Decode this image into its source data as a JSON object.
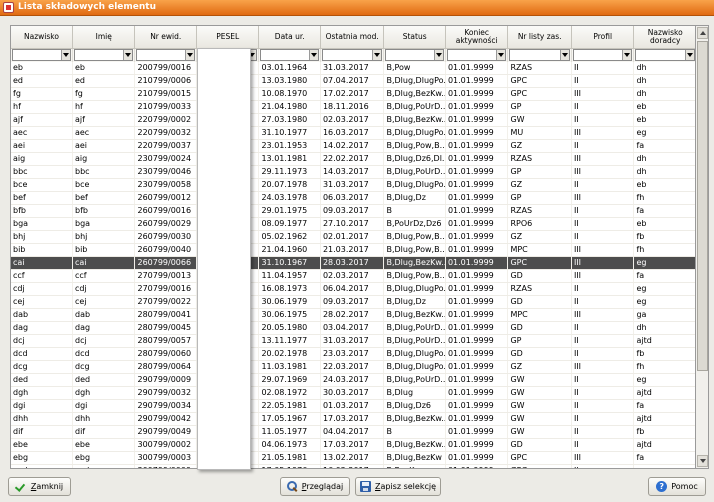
{
  "window": {
    "title": "Lista składowych elementu"
  },
  "columns": [
    "Nazwisko",
    "Imię",
    "Nr ewid.",
    "PESEL",
    "Data ur.",
    "Ostatnia mod.",
    "Status",
    "Koniec aktywności",
    "Nr listy zas.",
    "Profil",
    "Nazwisko doradcy"
  ],
  "rows": [
    [
      "eb",
      "eb",
      "200799/0016",
      "",
      "03.01.1964",
      "31.03.2017",
      "B,Pow",
      "01.01.9999",
      "RZAS",
      "II",
      "dh"
    ],
    [
      "ed",
      "ed",
      "210799/0006",
      "",
      "13.03.1980",
      "07.04.2017",
      "B,Dlug,DlugPo...",
      "01.01.9999",
      "GPC",
      "II",
      "dh"
    ],
    [
      "fg",
      "fg",
      "210799/0015",
      "",
      "10.08.1970",
      "17.02.2017",
      "B,Dlug,BezKw...",
      "01.01.9999",
      "GPC",
      "III",
      "dh"
    ],
    [
      "hf",
      "hf",
      "210799/0033",
      "",
      "21.04.1980",
      "18.11.2016",
      "B,Dlug,PoUrD...",
      "01.01.9999",
      "GP",
      "II",
      "eb"
    ],
    [
      "ajf",
      "ajf",
      "220799/0002",
      "",
      "27.03.1980",
      "02.03.2017",
      "B,Dlug,BezKw...",
      "01.01.9999",
      "GW",
      "II",
      "eb"
    ],
    [
      "aec",
      "aec",
      "220799/0032",
      "",
      "31.10.1977",
      "16.03.2017",
      "B,Dlug,DlugPo...",
      "01.01.9999",
      "MU",
      "III",
      "eg"
    ],
    [
      "aei",
      "aei",
      "220799/0037",
      "",
      "23.01.1953",
      "14.02.2017",
      "B,Dlug,Pow,B...",
      "01.01.9999",
      "GZ",
      "II",
      "fa"
    ],
    [
      "aig",
      "aig",
      "230799/0024",
      "",
      "13.01.1981",
      "22.02.2017",
      "B,Dlug,Dz6,Dl...",
      "01.01.9999",
      "RZAS",
      "III",
      "dh"
    ],
    [
      "bbc",
      "bbc",
      "230799/0046",
      "",
      "29.11.1973",
      "14.03.2017",
      "B,Dlug,PoUrD...",
      "01.01.9999",
      "GP",
      "III",
      "dh"
    ],
    [
      "bce",
      "bce",
      "230799/0058",
      "",
      "20.07.1978",
      "31.03.2017",
      "B,Dlug,DlugPo...",
      "01.01.9999",
      "GZ",
      "II",
      "eb"
    ],
    [
      "bef",
      "bef",
      "260799/0012",
      "",
      "24.03.1978",
      "06.03.2017",
      "B,Dlug,Dz",
      "01.01.9999",
      "GP",
      "III",
      "fh"
    ],
    [
      "bfb",
      "bfb",
      "260799/0016",
      "",
      "29.01.1975",
      "09.03.2017",
      "B",
      "01.01.9999",
      "RZAS",
      "II",
      "fa"
    ],
    [
      "bga",
      "bga",
      "260799/0029",
      "",
      "08.09.1977",
      "27.10.2017",
      "B,PoUrDz,Dz6",
      "01.01.9999",
      "RPO6",
      "II",
      "eb"
    ],
    [
      "bhj",
      "bhj",
      "260799/0030",
      "",
      "05.02.1962",
      "02.01.2017",
      "B,Dlug,Pow,B...",
      "01.01.9999",
      "GZ",
      "II",
      "fb"
    ],
    [
      "bib",
      "bib",
      "260799/0040",
      "",
      "21.04.1960",
      "21.03.2017",
      "B,Dlug,Pow,B...",
      "01.01.9999",
      "MPC",
      "III",
      "fh"
    ],
    [
      "cai",
      "cai",
      "260799/0066",
      "",
      "31.10.1967",
      "28.03.2017",
      "B,Dlug,BezKw...",
      "01.01.9999",
      "GPC",
      "III",
      "eg"
    ],
    [
      "ccf",
      "ccf",
      "270799/0013",
      "",
      "11.04.1957",
      "02.03.2017",
      "B,Dlug,Pow,B...",
      "01.01.9999",
      "GD",
      "III",
      "fa"
    ],
    [
      "cdj",
      "cdj",
      "270799/0016",
      "",
      "16.08.1973",
      "06.04.2017",
      "B,Dlug,DlugPo...",
      "01.01.9999",
      "RZAS",
      "II",
      "eg"
    ],
    [
      "cej",
      "cej",
      "270799/0022",
      "",
      "30.06.1979",
      "09.03.2017",
      "B,Dlug,Dz",
      "01.01.9999",
      "GD",
      "II",
      "eg"
    ],
    [
      "dab",
      "dab",
      "280799/0041",
      "",
      "30.06.1975",
      "28.02.2017",
      "B,Dlug,BezKw...",
      "01.01.9999",
      "MPC",
      "III",
      "ga"
    ],
    [
      "dag",
      "dag",
      "280799/0045",
      "",
      "20.05.1980",
      "03.04.2017",
      "B,Dlug,PoUrD...",
      "01.01.9999",
      "GD",
      "II",
      "dh"
    ],
    [
      "dcj",
      "dcj",
      "280799/0057",
      "",
      "13.11.1977",
      "31.03.2017",
      "B,Dlug,PoUrD...",
      "01.01.9999",
      "GP",
      "II",
      "ajtd"
    ],
    [
      "dcd",
      "dcd",
      "280799/0060",
      "",
      "20.02.1978",
      "23.03.2017",
      "B,Dlug,DlugPo...",
      "01.01.9999",
      "GD",
      "II",
      "fb"
    ],
    [
      "dcg",
      "dcg",
      "280799/0064",
      "",
      "11.03.1981",
      "22.03.2017",
      "B,Dlug,DlugPo...",
      "01.01.9999",
      "GZ",
      "III",
      "fh"
    ],
    [
      "ded",
      "ded",
      "290799/0009",
      "",
      "29.07.1969",
      "24.03.2017",
      "B,Dlug,PoUrD...",
      "01.01.9999",
      "GW",
      "II",
      "eg"
    ],
    [
      "dgh",
      "dgh",
      "290799/0032",
      "",
      "02.08.1972",
      "30.03.2017",
      "B,Dlug",
      "01.01.9999",
      "GW",
      "II",
      "ajtd"
    ],
    [
      "dgi",
      "dgi",
      "290799/0034",
      "",
      "22.05.1981",
      "01.03.2017",
      "B,Dlug,Dz6",
      "01.01.9999",
      "GW",
      "II",
      "fa"
    ],
    [
      "dhh",
      "dhh",
      "290799/0042",
      "",
      "17.05.1967",
      "17.03.2017",
      "B,Dlug,BezKw...",
      "01.01.9999",
      "GW",
      "II",
      "ajtd"
    ],
    [
      "dif",
      "dif",
      "290799/0049",
      "",
      "11.05.1977",
      "04.04.2017",
      "B",
      "01.01.9999",
      "GW",
      "II",
      "fb"
    ],
    [
      "ebe",
      "ebe",
      "300799/0002",
      "",
      "04.06.1973",
      "17.03.2017",
      "B,Dlug,BezKw...",
      "01.01.9999",
      "GD",
      "II",
      "ajtd"
    ],
    [
      "ebg",
      "ebg",
      "300799/0003",
      "",
      "21.05.1981",
      "13.02.2017",
      "B,Dlug,BezKw",
      "01.01.9999",
      "GPC",
      "III",
      "fa"
    ],
    [
      "ecd",
      "ecd",
      "300799/0009",
      "",
      "17.05.1976",
      "16.02.2017",
      "B,BezKw",
      "01.01.9999",
      "GPC",
      "II",
      "eg"
    ]
  ],
  "selected_row_index": 15,
  "buttons": {
    "close": "Zamknij",
    "close_mnemonic": "Z",
    "browse": "Przeglądaj",
    "browse_mnemonic": "P",
    "save": "Zapisz selekcję",
    "save_mnemonic": "Z",
    "help": "Pomoc"
  },
  "icons": {
    "title": "app-icon",
    "close": "check-icon",
    "browse": "search-icon",
    "save": "save-icon",
    "help": "help-icon"
  },
  "colors": {
    "titlebar": "#e87f22",
    "selected_row": "#4d4d4d"
  }
}
